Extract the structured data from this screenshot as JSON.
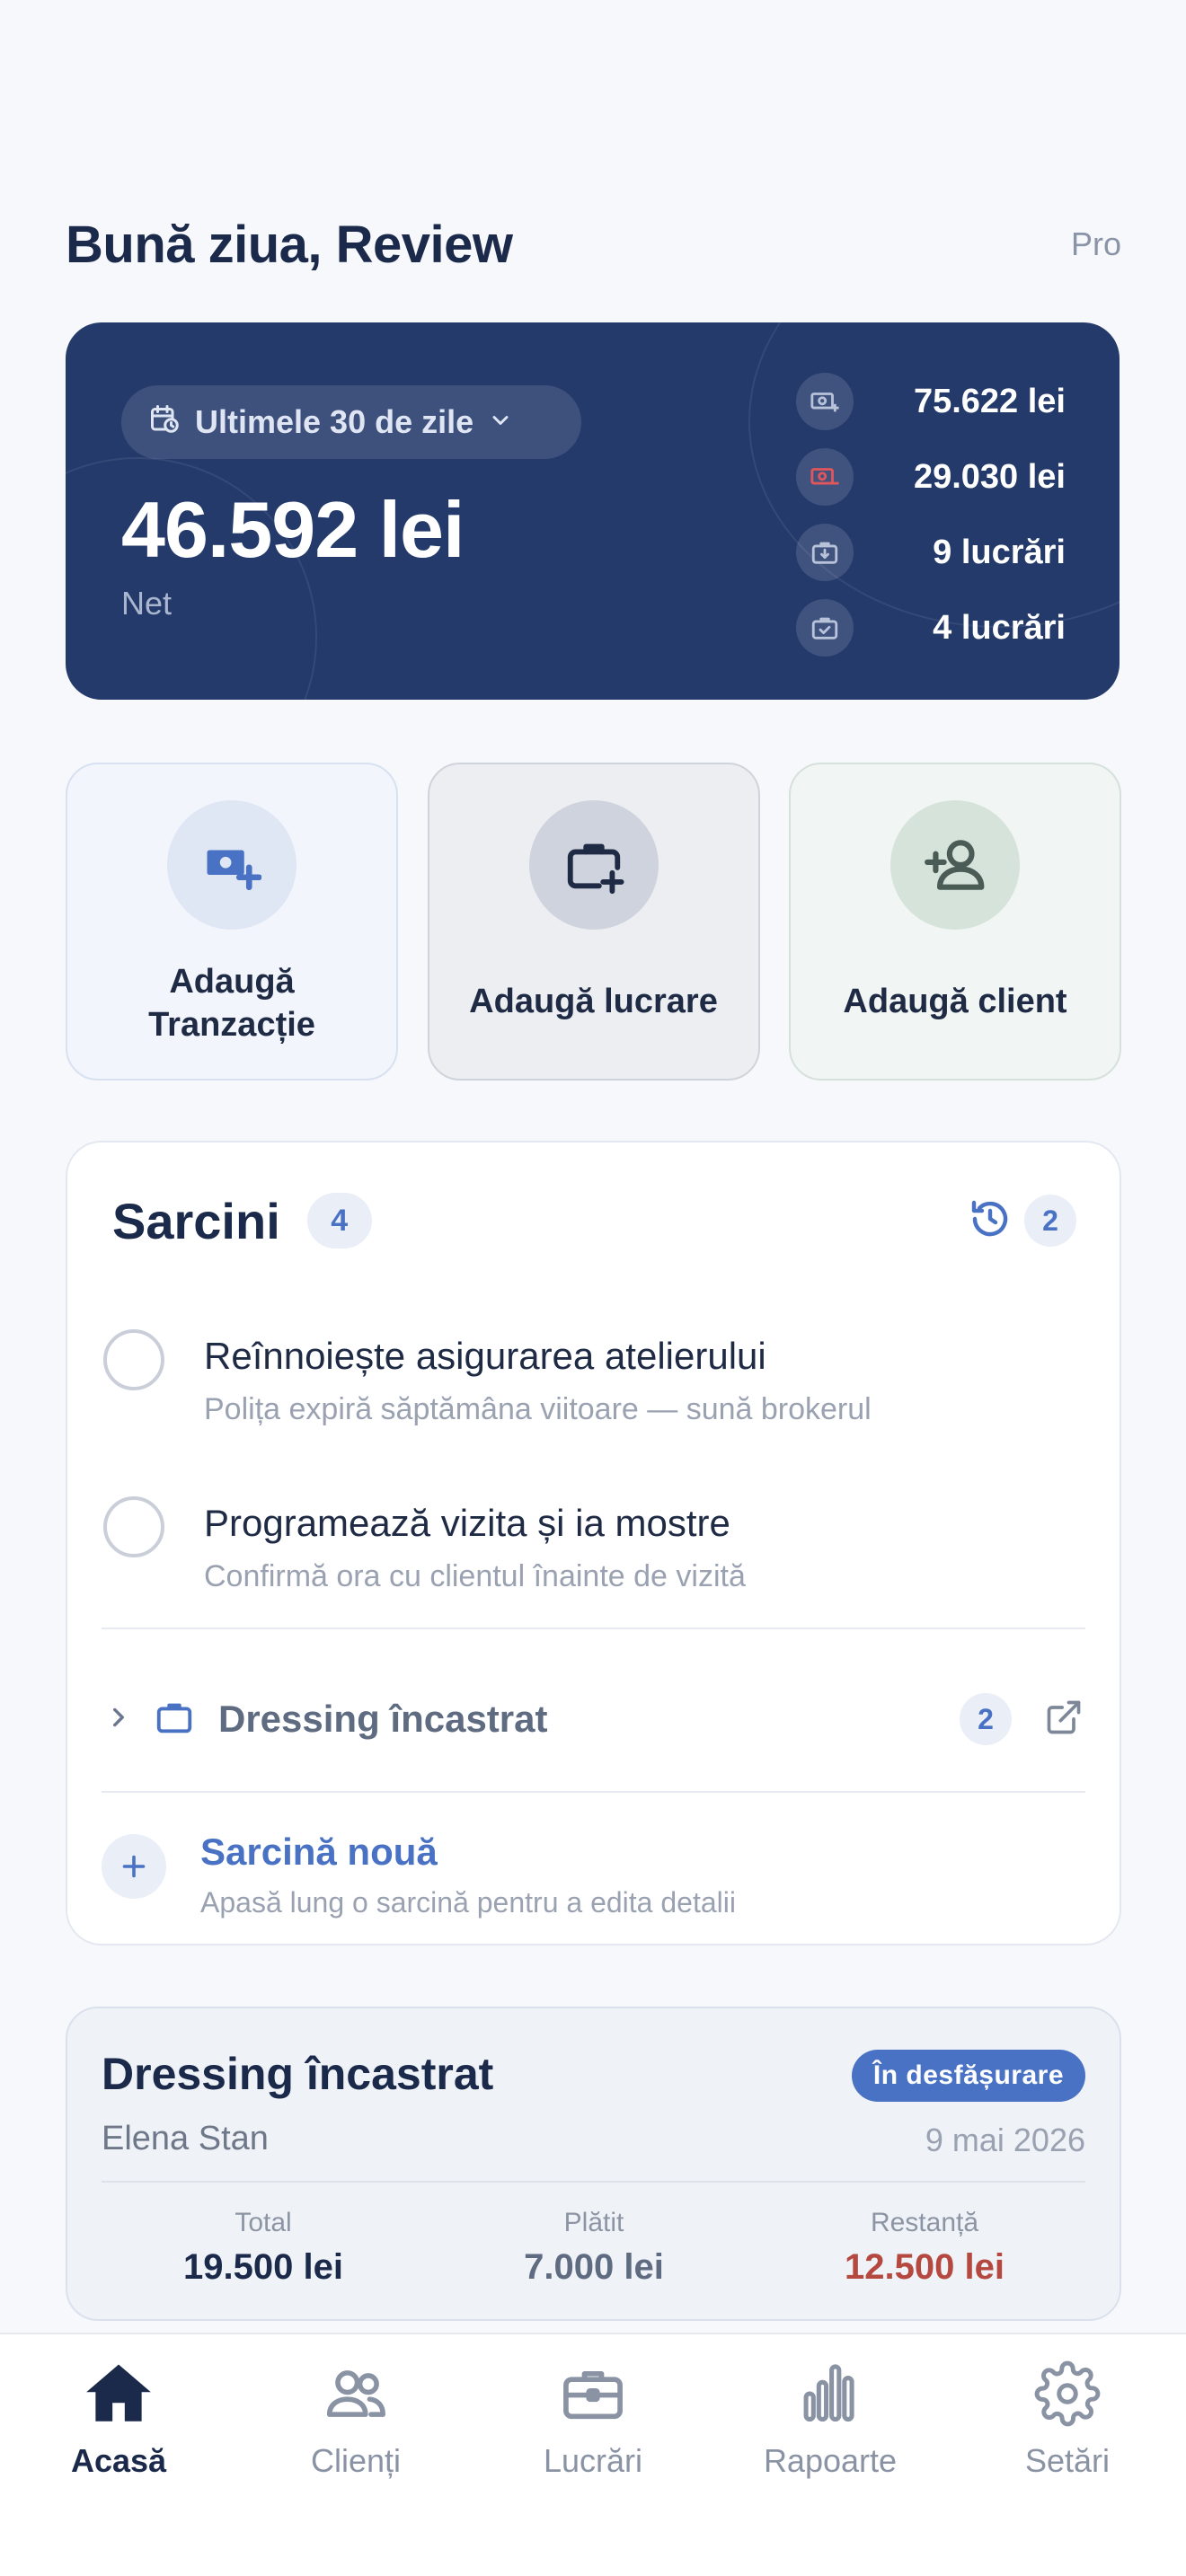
{
  "header": {
    "greeting": "Bună ziua, Review",
    "plan": "Pro"
  },
  "summary": {
    "period": "Ultimele 30 de zile",
    "net_amount": "46.592 lei",
    "net_label": "Net",
    "stats": [
      {
        "icon": "money-in-icon",
        "value": "75.622 lei"
      },
      {
        "icon": "money-out-icon",
        "value": "29.030 lei"
      },
      {
        "icon": "briefcase-down-icon",
        "value": "9 lucrări"
      },
      {
        "icon": "briefcase-check-icon",
        "value": "4 lucrări"
      }
    ],
    "colors": {
      "background": "#243a6b",
      "expense_icon": "#e0565b"
    }
  },
  "actions": [
    {
      "label": "Adaugă Tranzacție",
      "icon": "money-plus-icon"
    },
    {
      "label": "Adaugă lucrare",
      "icon": "briefcase-plus-icon"
    },
    {
      "label": "Adaugă client",
      "icon": "user-plus-icon"
    }
  ],
  "tasks": {
    "title": "Sarcini",
    "count": "4",
    "history_count": "2",
    "items": [
      {
        "title": "Reînnoiește asigurarea atelierului",
        "subtitle": "Polița expiră săptămâna viitoare — sună brokerul"
      },
      {
        "title": "Programează vizita și ia mostre",
        "subtitle": "Confirmă ora cu clientul înainte de vizită"
      }
    ],
    "project_group": {
      "name": "Dressing încastrat",
      "count": "2"
    },
    "new_task_label": "Sarcină nouă",
    "new_task_hint": "Apasă lung o sarcină pentru a edita detalii"
  },
  "project": {
    "title": "Dressing încastrat",
    "status": "În desfășurare",
    "client": "Elena Stan",
    "date": "9 mai 2026",
    "total_label": "Total",
    "total_value": "19.500 lei",
    "paid_label": "Plătit",
    "paid_value": "7.000 lei",
    "due_label": "Restanță",
    "due_value": "12.500 lei",
    "colors": {
      "status": "#4a72c4",
      "total": "#1b2a4a",
      "paid": "#5e6b80",
      "due": "#b5483f"
    }
  },
  "nav": {
    "items": [
      {
        "label": "Acasă",
        "icon": "home-icon",
        "active": true
      },
      {
        "label": "Clienți",
        "icon": "users-icon",
        "active": false
      },
      {
        "label": "Lucrări",
        "icon": "briefcase-icon",
        "active": false
      },
      {
        "label": "Rapoarte",
        "icon": "bar-chart-icon",
        "active": false
      },
      {
        "label": "Setări",
        "icon": "gear-icon",
        "active": false
      }
    ]
  }
}
